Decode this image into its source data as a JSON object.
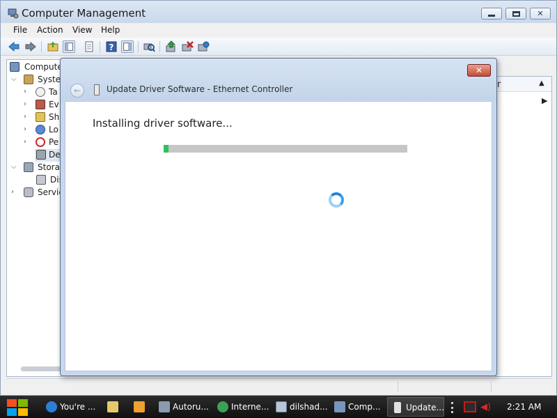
{
  "window": {
    "title": "Computer Management",
    "caption_buttons": [
      "minimize",
      "maximize",
      "close"
    ]
  },
  "menu": [
    "File",
    "Action",
    "View",
    "Help"
  ],
  "toolbar": {
    "buttons": [
      "back-icon",
      "forward-icon",
      "up-folder-icon",
      "show-hide-tree-icon",
      "properties-icon",
      "help-icon",
      "show-hide-action-pane-icon",
      "scan-hardware-icon",
      "update-driver-icon",
      "disable-device-icon",
      "uninstall-device-icon"
    ]
  },
  "tree": {
    "items": [
      {
        "label": "Computer",
        "icon": "computer-icon"
      },
      {
        "label": "System",
        "icon": "system-tools-icon"
      },
      {
        "label": "Ta",
        "icon": "task-scheduler-icon"
      },
      {
        "label": "Ev",
        "icon": "event-viewer-icon"
      },
      {
        "label": "Sh",
        "icon": "shared-folders-icon"
      },
      {
        "label": "Lo",
        "icon": "local-users-icon"
      },
      {
        "label": "Pe",
        "icon": "performance-icon"
      },
      {
        "label": "De",
        "icon": "device-manager-icon"
      },
      {
        "label": "Storag",
        "icon": "storage-icon"
      },
      {
        "label": "Dis",
        "icon": "disk-management-icon"
      },
      {
        "label": "Service",
        "icon": "services-icon"
      }
    ]
  },
  "right_pane": {
    "header_fragment": "r"
  },
  "dialog": {
    "title": "Update Driver Software - Ethernet Controller",
    "status_text": "Installing driver software...",
    "progress_fraction": 0.02,
    "close_label": "✕"
  },
  "taskbar": {
    "items": [
      {
        "label": "You're ...",
        "icon": "internet-explorer-icon",
        "active": false
      },
      {
        "label": "",
        "icon": "explorer-folder-icon",
        "active": false
      },
      {
        "label": "",
        "icon": "media-player-icon",
        "active": false
      },
      {
        "label": "Autoru...",
        "icon": "autoruns-icon",
        "active": false
      },
      {
        "label": "Interne...",
        "icon": "network-icon",
        "active": false
      },
      {
        "label": "dilshad...",
        "icon": "window-icon",
        "active": false
      },
      {
        "label": "Comp...",
        "icon": "computer-management-icon",
        "active": false
      },
      {
        "label": "Update...",
        "icon": "update-driver-icon",
        "active": true
      }
    ],
    "clock": "2:21 AM"
  },
  "colors": {
    "progress_fill": "#2fc05b",
    "dialog_close": "#c74a33",
    "taskbar": "#111111",
    "tray_alert": "#c21c1c"
  }
}
